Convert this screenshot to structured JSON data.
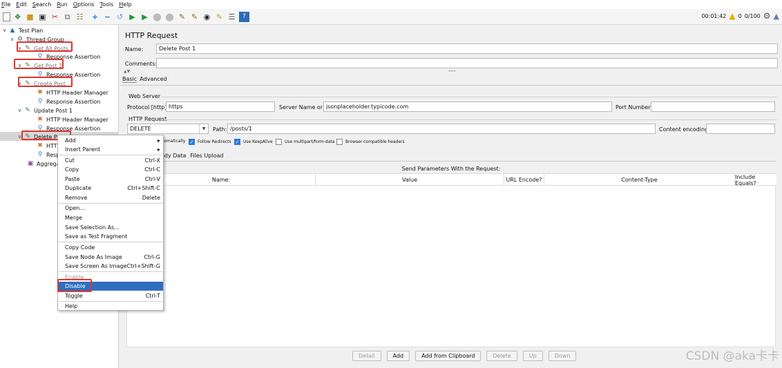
{
  "menu": [
    "File",
    "Edit",
    "Search",
    "Run",
    "Options",
    "Tools",
    "Help"
  ],
  "toolbar": {
    "timer": "00:01:42",
    "warning_count": "0",
    "threads": "0/100",
    "colors": {
      "run": "#1a9a3a",
      "accent": "#2b7bd6"
    }
  },
  "tree": {
    "test_plan": "Test Plan",
    "thread_group": "Thread Group",
    "get_all_posts": "Get All Posts",
    "response_assertion": "Response Assertion",
    "get_post_1": "Get Post 1",
    "create_post": "Create Post",
    "http_header_manager": "HTTP Header Manager",
    "update_post_1": "Update Post 1",
    "delete_post_short": "Delete P",
    "http_short": "HTTI",
    "resp_short": "Resp",
    "aggregate_short": "Aggrega"
  },
  "panel": {
    "title": "HTTP Request",
    "name_label": "Name:",
    "name_value": "Delete Post 1",
    "comments_label": "Comments:",
    "tab_basic": "Basic",
    "tab_advanced": "Advanced",
    "web_server": "Web Server",
    "protocol_label": "Protocol [http]:",
    "protocol_value": "https",
    "server_label": "Server Name or IP:",
    "server_value": "jsonplaceholder.typicode.com",
    "port_label": "Port Number:",
    "http_request": "HTTP Request",
    "method": "DELETE",
    "path_label": "Path:",
    "path_value": "/posts/1",
    "encoding_label": "Content encoding:",
    "chk_auto": "tomatically",
    "chk_follow": "Follow Redirects",
    "chk_keepalive": "Use KeepAlive",
    "chk_multipart": "Use multipart/form-data",
    "chk_browser": "Browser-compatible headers",
    "subtab_body": "ody Data",
    "subtab_files": "Files Upload",
    "params_title": "Send Parameters With the Request:",
    "columns": [
      "Name:",
      "Value",
      "URL Encode?",
      "Content-Type",
      "Include Equals?"
    ],
    "buttons": [
      "Detail",
      "Add",
      "Add from Clipboard",
      "Delete",
      "Up",
      "Down"
    ]
  },
  "context_menu": [
    {
      "label": "Add",
      "shortcut": "",
      "sub": true
    },
    {
      "label": "Insert Parent",
      "shortcut": "",
      "sub": true
    },
    {
      "label": "Cut",
      "shortcut": "Ctrl-X"
    },
    {
      "label": "Copy",
      "shortcut": "Ctrl-C"
    },
    {
      "label": "Paste",
      "shortcut": "Ctrl-V"
    },
    {
      "label": "Duplicate",
      "shortcut": "Ctrl+Shift-C"
    },
    {
      "label": "Remove",
      "shortcut": "Delete"
    },
    {
      "label": "Open...",
      "shortcut": ""
    },
    {
      "label": "Merge",
      "shortcut": ""
    },
    {
      "label": "Save Selection As...",
      "shortcut": ""
    },
    {
      "label": "Save as Test Fragment",
      "shortcut": ""
    },
    {
      "label": "Copy Code",
      "shortcut": ""
    },
    {
      "label": "Save Node As Image",
      "shortcut": "Ctrl-G"
    },
    {
      "label": "Save Screen As Image",
      "shortcut": "Ctrl+Shift-G"
    },
    {
      "label": "Enable",
      "shortcut": ""
    },
    {
      "label": "Disable",
      "shortcut": ""
    },
    {
      "label": "Toggle",
      "shortcut": "Ctrl-T"
    },
    {
      "label": "Help",
      "shortcut": ""
    }
  ],
  "watermark": "CSDN @aka卡卡"
}
